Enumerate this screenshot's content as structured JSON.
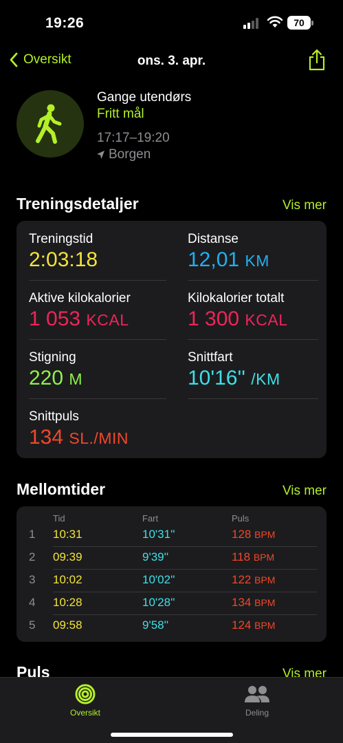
{
  "status_bar": {
    "time": "19:26",
    "battery": "70"
  },
  "nav": {
    "back_label": "Oversikt",
    "title": "ons. 3. apr."
  },
  "workout": {
    "type": "Gange utendørs",
    "goal": "Fritt mål",
    "time_range": "17:17–19:20",
    "location": "Borgen"
  },
  "details": {
    "title": "Treningsdetaljer",
    "more": "Vis mer",
    "metrics": {
      "duration": {
        "label": "Treningstid",
        "value": "2:03:18",
        "unit": ""
      },
      "distance": {
        "label": "Distanse",
        "value": "12,01",
        "unit": "KM"
      },
      "active_kcal": {
        "label": "Aktive kilokalorier",
        "value": "1 053",
        "unit": "KCAL"
      },
      "total_kcal": {
        "label": "Kilokalorier totalt",
        "value": "1 300",
        "unit": "KCAL"
      },
      "elevation": {
        "label": "Stigning",
        "value": "220",
        "unit": "M"
      },
      "pace": {
        "label": "Snittfart",
        "value": "10'16''",
        "unit": "/KM"
      },
      "heart_rate": {
        "label": "Snittpuls",
        "value": "134",
        "unit": "SL./MIN"
      }
    }
  },
  "splits": {
    "title": "Mellomtider",
    "more": "Vis mer",
    "headers": {
      "time": "Tid",
      "pace": "Fart",
      "hr": "Puls"
    },
    "rows": [
      {
        "n": "1",
        "time": "10:31",
        "pace": "10'31''",
        "hr": "128",
        "unit": "BPM"
      },
      {
        "n": "2",
        "time": "09:39",
        "pace": "9'39''",
        "hr": "118",
        "unit": "BPM"
      },
      {
        "n": "3",
        "time": "10:02",
        "pace": "10'02''",
        "hr": "122",
        "unit": "BPM"
      },
      {
        "n": "4",
        "time": "10:28",
        "pace": "10'28''",
        "hr": "134",
        "unit": "BPM"
      },
      {
        "n": "5",
        "time": "09:58",
        "pace": "9'58''",
        "hr": "124",
        "unit": "BPM"
      }
    ]
  },
  "next_section": {
    "title": "Puls",
    "more": "Vis mer"
  },
  "tabs": [
    {
      "label": "Oversikt",
      "icon": "activity-rings-icon",
      "active": true
    },
    {
      "label": "Deling",
      "icon": "people-icon",
      "active": false
    }
  ],
  "colors": {
    "accent": "#b4f028",
    "duration": "#f2e33a",
    "distance": "#21b0f0",
    "kcal": "#f0245a",
    "elevation": "#8ef24a",
    "pace": "#3ee0e8",
    "heart_rate": "#f2472a"
  }
}
